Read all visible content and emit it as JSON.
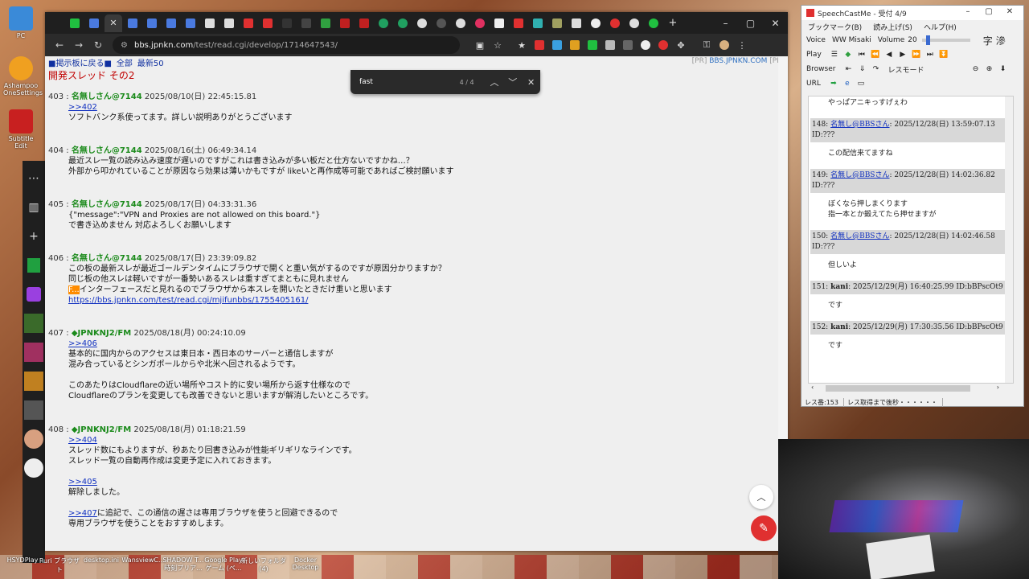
{
  "desktop": {
    "icons": [
      {
        "label": "PC",
        "color": "#3a8ad8"
      },
      {
        "label": "Ashampoo\nOneSettings",
        "color": "#f0a020"
      },
      {
        "label": "Subtitle Edit",
        "color": "#c82020"
      }
    ],
    "taskbar": [
      "HSYDPlay",
      "Ruri ブラウザ\nト",
      "desktop.ini",
      "WansviewC...",
      "SHADOW T...\n時刻プリア...",
      "Google Play\nゲーム (ベ...",
      "新しいフォルダ\n(4)",
      "Docker\nDesktop"
    ]
  },
  "browser": {
    "url_host": "bbs.jpnkn.com",
    "url_path": "/test/read.cgi/develop/1714647543/",
    "nav": {
      "back_to_board": "■掲示板に戻る■",
      "all": "全部",
      "latest": "最新50"
    },
    "pr_left": "[PR]",
    "pr_site": "BBS.JPNKN.COM",
    "pr_right": "[PR]",
    "thread_title": "開発スレッド その2",
    "find": {
      "query": "fast",
      "count": "4 / 4"
    },
    "posts": [
      {
        "header_num": "403 :",
        "name": "名無しさん@7144",
        "date": "2025/08/10(日) 22:45:15.81",
        "lines": [
          {
            "anchor": ">>402"
          },
          {
            "text": "ソフトバンク系使ってます。詳しい説明ありがとうございます"
          }
        ]
      },
      {
        "header_num": "404 :",
        "name": "名無しさん@7144",
        "date": "2025/08/16(土) 06:49:34.14",
        "lines": [
          {
            "text": "最近スレ一覧の読み込み速度が遅いのですがこれは書き込みが多い板だと仕方ないですかね…？"
          },
          {
            "text": "外部から叩かれていることが原因なら効果は薄いかもですが likeいと再作成等可能であればご検討願います"
          }
        ]
      },
      {
        "header_num": "405 :",
        "name": "名無しさん@7144",
        "date": "2025/08/17(日) 04:33:31.36",
        "lines": [
          {
            "text": "{\"message\":\"VPN and Proxies are not allowed on this board.\"}"
          },
          {
            "text": "で書き込めません 対応よろしくお願いします"
          }
        ]
      },
      {
        "header_num": "406 :",
        "name": "名無しさん@7144",
        "date": "2025/08/17(日) 23:39:09.82",
        "lines": [
          {
            "text": "この板の最新スレが最近ゴールデンタイムにブラウザで開くと重い気がするのですが原因分かりますか？"
          },
          {
            "text": "同じ板の他スレは軽いですが一番勢いあるスレは重すぎてまともに見れません"
          },
          {
            "hl": "F...",
            "text": "インターフェースだと見れるのでブラウザから本スレを開いたときだけ重いと思います"
          },
          {
            "anchor": "https://bbs.jpnkn.com/test/read.cgi/mjifunbbs/1755405161/"
          }
        ]
      },
      {
        "header_num": "407 :",
        "name": "◆JPNKNJ2/FM",
        "date": "2025/08/18(月) 00:24:10.09",
        "lines": [
          {
            "anchor": ">>406"
          },
          {
            "text": "基本的に国内からのアクセスは東日本・西日本のサーバーと通信しますが"
          },
          {
            "text": "混み合っているとシンガポールからや北米へ回されるようです。"
          },
          {
            "text": ""
          },
          {
            "text": "このあたりはCloudflareの近い場所やコスト的に安い場所から返す仕様なので"
          },
          {
            "text": "Cloudflareのプランを変更しても改善できないと思いますが解消したいところです。"
          }
        ]
      },
      {
        "header_num": "408 :",
        "name": "◆JPNKNJ2/FM",
        "date": "2025/08/18(月) 01:18:21.59",
        "lines": [
          {
            "anchor": ">>404"
          },
          {
            "text": "スレッド数にもよりますが、秒あたり回書き込みが性能ギリギリなラインです。"
          },
          {
            "text": "スレッド一覧の自動再作成は変更予定に入れておきます。"
          },
          {
            "text": ""
          },
          {
            "anchor": ">>405"
          },
          {
            "text": "解除しました。"
          },
          {
            "text": ""
          },
          {
            "anchor": ">>407",
            "text": "に追記で、この通信の遅さは専用ブラウザを使うと回避できるので"
          },
          {
            "text": "専用ブラウザを使うことをおすすめします。"
          }
        ]
      }
    ]
  },
  "speechcast": {
    "title": "SpeechCastMe - 受付 4/9",
    "menu": [
      "ブックマーク(B)",
      "読み上げ(S)",
      "ヘルプ(H)"
    ],
    "voice_label": "Voice",
    "voice": "WW Misaki",
    "volume_label": "Volume",
    "volume": "20",
    "volume_fraction": 0.1,
    "play_label": "Play",
    "browser_label": "Browser",
    "res_label": "レスモード",
    "url_label": "URL",
    "entries": [
      {
        "head": null,
        "body": "やっぱアニキっすげぇわ"
      },
      {
        "head": {
          "num": "148:",
          "name": "名無し@BBSさん",
          "date": ": 2025/12/28(日) 13:59:07.13",
          "id": "ID:???"
        },
        "body": "この配信来てますね"
      },
      {
        "head": {
          "num": "149:",
          "name": "名無し@BBSさん",
          "date": ": 2025/12/28(日) 14:02:36.82",
          "id": "ID:???"
        },
        "body": "ぼくなら押しまくります\n指一本とか鍛えてたら押せますが"
      },
      {
        "head": {
          "num": "150:",
          "name": "名無し@BBSさん",
          "date": ": 2025/12/28(日) 14:02:46.58",
          "id": "ID:???"
        },
        "body": "但しいよ"
      },
      {
        "head": {
          "num": "151:",
          "name": "kani",
          "date": ": 2025/12/29(月) 16:40:25.99 ID:bBPscOt9",
          "id": ""
        },
        "body": "です"
      },
      {
        "head": {
          "num": "152:",
          "name": "kani",
          "date": ": 2025/12/29(月) 17:30:35.56 ID:bBPscOt9",
          "id": ""
        },
        "body": "です"
      }
    ],
    "status_left": "レス番:153",
    "status_right": "レス取得まで後秒・・・・・・"
  }
}
